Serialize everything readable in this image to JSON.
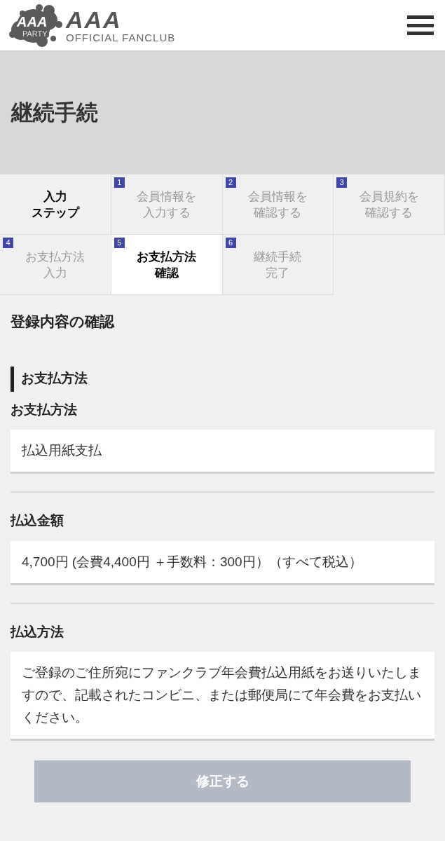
{
  "header": {
    "logo_mark_text": "AAA",
    "logo_mark_subtext": "PARTY",
    "logo_title": "AAA",
    "logo_subtitle": "OFFICIAL FANCLUB"
  },
  "page_title": "継続手続",
  "steps": {
    "heading_lines": [
      "入力",
      "ステップ"
    ],
    "items": [
      {
        "number": "1",
        "label_lines": [
          "会員情報を",
          "入力する"
        ],
        "selected": false
      },
      {
        "number": "2",
        "label_lines": [
          "会員情報を",
          "確認する"
        ],
        "selected": false
      },
      {
        "number": "3",
        "label_lines": [
          "会員規約を",
          "確認する"
        ],
        "selected": false
      },
      {
        "number": "4",
        "label_lines": [
          "お支払方法",
          "入力"
        ],
        "selected": false
      },
      {
        "number": "5",
        "label_lines": [
          "お支払方法",
          "確認"
        ],
        "selected": true
      },
      {
        "number": "6",
        "label_lines": [
          "継続手続",
          "完了"
        ],
        "selected": false
      }
    ]
  },
  "section_title": "登録内容の確認",
  "group_title": "お支払方法",
  "fields": [
    {
      "label": "お支払方法",
      "value": "払込用紙支払"
    },
    {
      "label": "払込金額",
      "value": "4,700円 (会費4,400円 ＋手数料：300円）（すべて税込）"
    },
    {
      "label": "払込方法",
      "value": "ご登録のご住所宛にファンクラブ年会費払込用紙をお送りいたしますので、記載されたコンビニ、または郵便局にて年会費をお支払いください。"
    }
  ],
  "button": {
    "label": "修正する",
    "disabled": true
  }
}
